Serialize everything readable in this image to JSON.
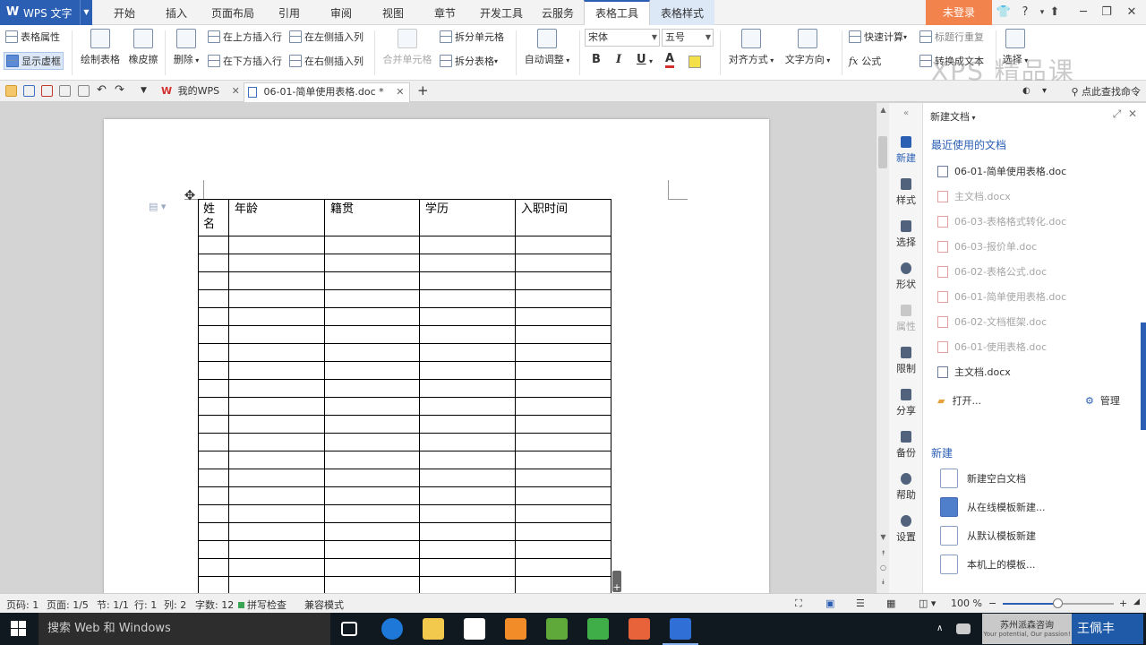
{
  "app": {
    "title": "WPS 文字",
    "logo": "W"
  },
  "menu": {
    "tabs": [
      "开始",
      "插入",
      "页面布局",
      "引用",
      "审阅",
      "视图",
      "章节",
      "开发工具",
      "云服务",
      "表格工具",
      "表格样式"
    ],
    "active": "表格工具",
    "login": "未登录",
    "help": "?"
  },
  "ribbon": {
    "table_props": "表格属性",
    "show_gridlines": "显示虚框",
    "draw_table": "绘制表格",
    "eraser": "橡皮擦",
    "delete": "删除",
    "insert_above": "在上方插入行",
    "insert_below": "在下方插入行",
    "insert_left": "在左侧插入列",
    "insert_right": "在右侧插入列",
    "merge_cells": "合并单元格",
    "split_cell": "拆分单元格",
    "split_table": "拆分表格",
    "auto_fit": "自动调整",
    "font_name": "宋体",
    "font_size": "五号",
    "bold": "B",
    "italic": "I",
    "underline": "U",
    "font_color": "A",
    "align": "对齐方式",
    "text_direction": "文字方向",
    "quick_calc": "快速计算",
    "formula": "公式",
    "repeat_header": "标题行重复",
    "convert_text": "转换成文本",
    "select": "选择",
    "watermark": "XPS 精品课"
  },
  "doc_tabs": {
    "home": "我的WPS",
    "current": "06-01-简单使用表格.doc *",
    "search_cmd": "点此查找命令"
  },
  "table": {
    "headers": [
      "姓\n名",
      "年龄",
      "籍贯",
      "学历",
      "入职时间"
    ],
    "empty_rows": 20
  },
  "sidebar": {
    "items": [
      "新建",
      "样式",
      "选择",
      "形状",
      "属性",
      "限制",
      "分享",
      "备份",
      "帮助",
      "设置"
    ]
  },
  "taskpane": {
    "title": "新建文档",
    "recent_header": "最近使用的文档",
    "recent": [
      {
        "name": "06-01-简单使用表格.doc",
        "dim": false
      },
      {
        "name": "主文档.docx",
        "dim": true
      },
      {
        "name": "06-03-表格格式转化.doc",
        "dim": true
      },
      {
        "name": "06-03-报价单.doc",
        "dim": true
      },
      {
        "name": "06-02-表格公式.doc",
        "dim": true
      },
      {
        "name": "06-01-简单使用表格.doc",
        "dim": true
      },
      {
        "name": "06-02-文档框架.doc",
        "dim": true
      },
      {
        "name": "06-01-使用表格.doc",
        "dim": true
      },
      {
        "name": "主文档.docx",
        "dim": false
      }
    ],
    "open": "打开...",
    "manage": "管理",
    "new_header": "新建",
    "new_items": [
      "新建空白文档",
      "从在线模板新建...",
      "从默认模板新建",
      "本机上的模板..."
    ]
  },
  "status": {
    "page_no": "页码: 1",
    "pages": "页面: 1/5",
    "section": "节: 1/1",
    "row": "行: 1",
    "col": "列: 2",
    "word_count": "字数: 12",
    "spell_check": "拼写检查",
    "compat": "兼容模式",
    "zoom": "100 %",
    "zoom_level": 0.5
  },
  "taskbar": {
    "search": "搜索 Web 和 Windows",
    "brand_line1": "苏州派森咨询",
    "brand_line2": "Your potential, Our passion!",
    "user": "王佩丰"
  },
  "colors": {
    "accent": "#2b5fb4",
    "login": "#f2834d",
    "taskbar": "#101820"
  }
}
